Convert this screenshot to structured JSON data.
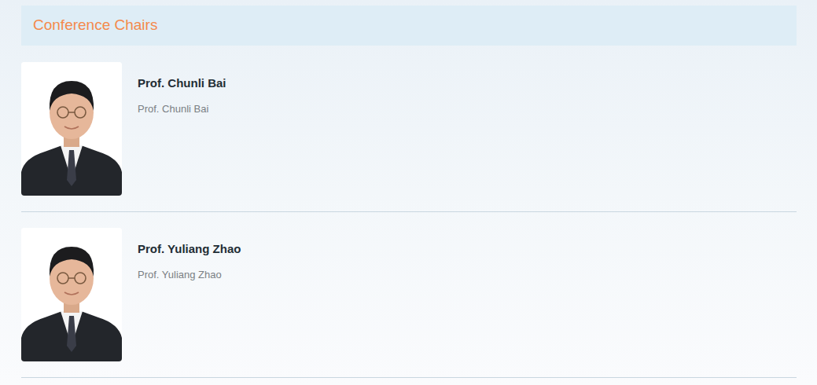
{
  "section": {
    "title": "Conference Chairs"
  },
  "chairs": [
    {
      "name": "Prof. Chunli Bai",
      "subtitle": "Prof. Chunli Bai"
    },
    {
      "name": "Prof. Yuliang Zhao",
      "subtitle": "Prof. Yuliang Zhao"
    }
  ]
}
